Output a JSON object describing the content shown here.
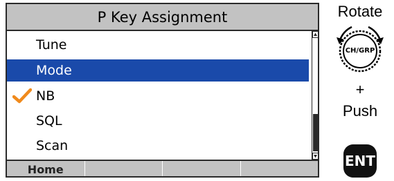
{
  "screen": {
    "title": "P Key Assignment",
    "items": [
      {
        "label": "Tune",
        "selected": false,
        "checked": false
      },
      {
        "label": "Mode",
        "selected": true,
        "checked": false
      },
      {
        "label": "NB",
        "selected": false,
        "checked": true
      },
      {
        "label": "SQL",
        "selected": false,
        "checked": false
      },
      {
        "label": "Scan",
        "selected": false,
        "checked": false
      }
    ],
    "softkeys": [
      "Home",
      "",
      "",
      ""
    ],
    "colors": {
      "title_bg": "#c2c2c2",
      "selection": "#1a4aaa",
      "check": "#f08a1c"
    }
  },
  "controls": {
    "rotate_label": "Rotate",
    "dial_label": "CH/GRP",
    "plus_label": "+",
    "push_label": "Push",
    "ent_label": "ENT"
  }
}
